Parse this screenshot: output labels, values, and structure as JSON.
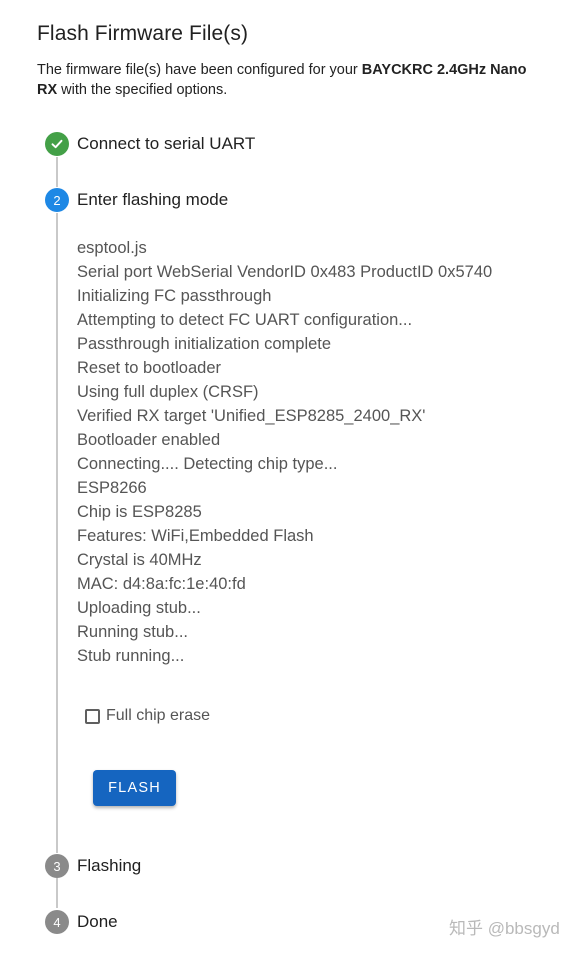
{
  "header": {
    "title": "Flash Firmware File(s)",
    "description_prefix": "The firmware file(s) have been configured for your ",
    "device_name_line1": "BAYCKRC 2.4GHz Nano",
    "device_name_line2": "RX",
    "description_suffix": " with the specified options."
  },
  "steps": [
    {
      "number": "1",
      "label": "Connect to serial UART",
      "state": "completed",
      "icon": "check-icon"
    },
    {
      "number": "2",
      "label": "Enter flashing mode",
      "state": "active"
    },
    {
      "number": "3",
      "label": "Flashing",
      "state": "pending"
    },
    {
      "number": "4",
      "label": "Done",
      "state": "pending"
    }
  ],
  "log": [
    "esptool.js",
    "Serial port WebSerial VendorID 0x483 ProductID 0x5740",
    "Initializing FC passthrough",
    "Attempting to detect FC UART configuration...",
    "Passthrough initialization complete",
    "Reset to bootloader",
    "Using full duplex (CRSF)",
    "Verified RX target 'Unified_ESP8285_2400_RX'",
    "Bootloader enabled",
    "Connecting.... Detecting chip type...",
    "ESP8266",
    "Chip is ESP8285",
    "Features: WiFi,Embedded Flash",
    "Crystal is 40MHz",
    "MAC: d4:8a:fc:1e:40:fd",
    "Uploading stub...",
    "Running stub...",
    "Stub running..."
  ],
  "options": {
    "full_chip_erase_label": "Full chip erase",
    "full_chip_erase_checked": false
  },
  "actions": {
    "flash_label": "FLASH"
  },
  "watermark": "知乎 @bbsgyd",
  "colors": {
    "completed": "#43a047",
    "active": "#1e88e5",
    "pending": "#8a8a8a",
    "button": "#1565c0"
  }
}
